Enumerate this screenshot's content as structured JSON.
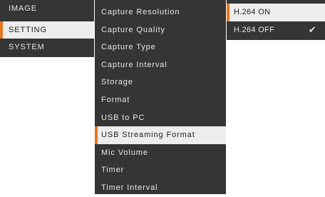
{
  "menus": {
    "main": [
      {
        "label": "IMAGE",
        "selected": false
      },
      {
        "label": "SETTING",
        "selected": true
      },
      {
        "label": "SYSTEM",
        "selected": false
      }
    ],
    "setting": [
      {
        "label": "Capture Resolution",
        "selected": false
      },
      {
        "label": "Capture Quality",
        "selected": false
      },
      {
        "label": "Capture Type",
        "selected": false
      },
      {
        "label": "Capture Interval",
        "selected": false
      },
      {
        "label": "Storage",
        "selected": false
      },
      {
        "label": "Format",
        "selected": false
      },
      {
        "label": "USB to PC",
        "selected": false
      },
      {
        "label": "USB Streaming Format",
        "selected": true
      },
      {
        "label": "Mic Volume",
        "selected": false
      },
      {
        "label": "Timer",
        "selected": false
      },
      {
        "label": "Timer Interval",
        "selected": false
      }
    ],
    "streaming": [
      {
        "label": "H.264 ON",
        "selected": true,
        "checked": false
      },
      {
        "label": "H.264 OFF",
        "selected": false,
        "checked": true,
        "check_icon": "checkmark-icon"
      }
    ]
  },
  "colors": {
    "menu_bg": "#353535",
    "highlight_bg": "#ededed",
    "accent": "#e8741f",
    "text": "#e8e8e8"
  }
}
